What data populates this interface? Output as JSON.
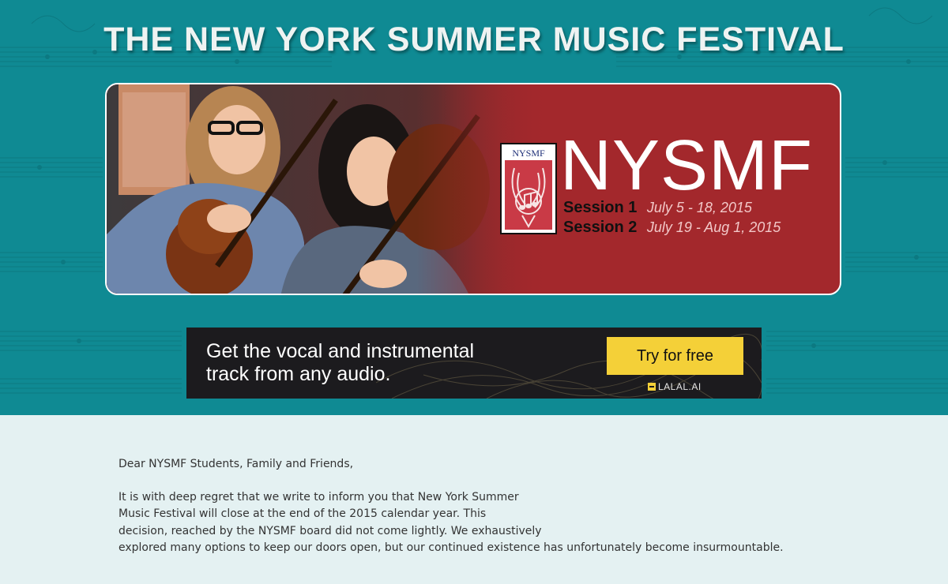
{
  "header": {
    "title": "THE NEW YORK SUMMER MUSIC FESTIVAL"
  },
  "banner": {
    "logo_text": "NYSMF",
    "name": "NYSMF",
    "sessions": [
      {
        "label": "Session 1",
        "dates": "July 5 - 18, 2015"
      },
      {
        "label": "Session 2",
        "dates": "July 19 - Aug 1, 2015"
      }
    ]
  },
  "ad": {
    "headline_line1": "Get the vocal and instrumental",
    "headline_line2": "track from any audio.",
    "cta": "Try for free",
    "brand": "LALAL.AI"
  },
  "letter": {
    "greeting": "Dear NYSMF Students, Family and Friends,",
    "lines": [
      "It is with deep regret that we write to inform you that New York Summer",
      "Music Festival will close at the end of the 2015 calendar year. This",
      "decision, reached by the NYSMF board did not come lightly. We exhaustively",
      "explored many options to keep our doors open, but our continued existence has unfortunately become insurmountable."
    ]
  },
  "colors": {
    "hero_teal": "#0f8a93",
    "banner_red": "#a3282c",
    "ad_dark": "#1c1b1e",
    "cta_yellow": "#f4d038",
    "page_bg": "#e4f1f2"
  }
}
